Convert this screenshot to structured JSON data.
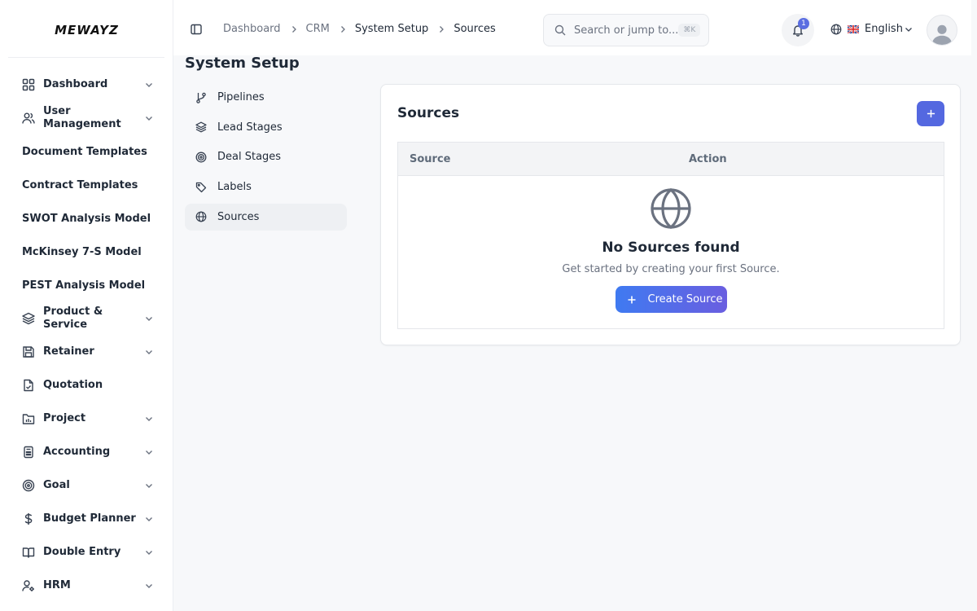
{
  "brand": {
    "logo": "MEWAYZ"
  },
  "sidebar": {
    "items": [
      {
        "label": "Dashboard",
        "icon": "grid-icon",
        "has_chevron": true
      },
      {
        "label": "User Management",
        "icon": "users-icon",
        "has_chevron": true
      },
      {
        "label": "Document Templates",
        "icon": "",
        "has_chevron": false
      },
      {
        "label": "Contract Templates",
        "icon": "",
        "has_chevron": false
      },
      {
        "label": "SWOT Analysis Model",
        "icon": "",
        "has_chevron": false
      },
      {
        "label": "McKinsey 7-S Model",
        "icon": "",
        "has_chevron": false
      },
      {
        "label": "PEST Analysis Model",
        "icon": "",
        "has_chevron": false
      },
      {
        "label": "Product & Service",
        "icon": "layers-icon",
        "has_chevron": true
      },
      {
        "label": "Retainer",
        "icon": "save-icon",
        "has_chevron": true
      },
      {
        "label": "Quotation",
        "icon": "file-check-icon",
        "has_chevron": false
      },
      {
        "label": "Project",
        "icon": "folder-chart-icon",
        "has_chevron": true
      },
      {
        "label": "Accounting",
        "icon": "calculator-icon",
        "has_chevron": true
      },
      {
        "label": "Goal",
        "icon": "target-icon",
        "has_chevron": true
      },
      {
        "label": "Budget Planner",
        "icon": "dollar-icon",
        "has_chevron": true
      },
      {
        "label": "Double Entry",
        "icon": "book-icon",
        "has_chevron": true
      },
      {
        "label": "HRM",
        "icon": "user-cog-icon",
        "has_chevron": true
      }
    ]
  },
  "header": {
    "breadcrumb": [
      "Dashboard",
      "CRM",
      "System Setup",
      "Sources"
    ],
    "search": {
      "placeholder": "Search or jump to...",
      "shortcut": "⌘K"
    },
    "notifications": {
      "count": "1"
    },
    "language": {
      "label": "English",
      "flag": "uk-flag"
    }
  },
  "page": {
    "title": "System Setup",
    "subnav": [
      {
        "label": "Pipelines",
        "icon": "git-branch-icon",
        "active": false
      },
      {
        "label": "Lead Stages",
        "icon": "layers-icon",
        "active": false
      },
      {
        "label": "Deal Stages",
        "icon": "target-icon",
        "active": false
      },
      {
        "label": "Labels",
        "icon": "tag-icon",
        "active": false
      },
      {
        "label": "Sources",
        "icon": "globe-icon",
        "active": true
      }
    ]
  },
  "card": {
    "title": "Sources",
    "table": {
      "columns": [
        "Source",
        "Action"
      ]
    },
    "empty": {
      "title": "No Sources found",
      "subtitle": "Get started by creating your first Source.",
      "button": "Create Source"
    }
  },
  "colors": {
    "primary": "#5468e0",
    "gradient_start": "#3f7af1",
    "gradient_end": "#6a5ee0",
    "badge": "#5b6ee1"
  }
}
